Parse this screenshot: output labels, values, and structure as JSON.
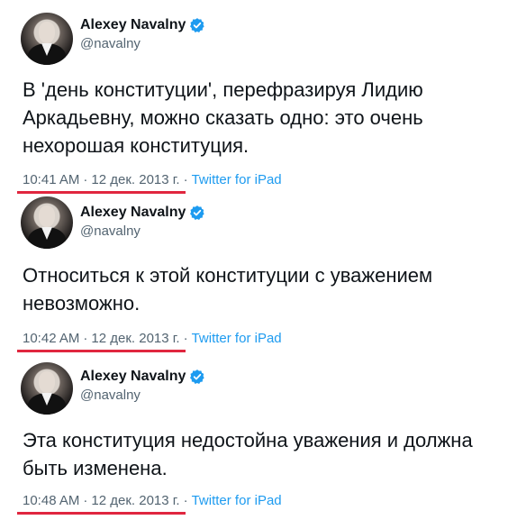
{
  "tweets": [
    {
      "author_name": "Alexey Navalny",
      "handle": "@navalny",
      "text": "В 'день конституции', перефразируя Лидию Аркадьевну, можно сказать одно: это очень нехорошая конституция.",
      "time": "10:41 AM",
      "date": "12 дек. 2013 г.",
      "source": "Twitter for iPad"
    },
    {
      "author_name": "Alexey Navalny",
      "handle": "@navalny",
      "text": "Относиться к этой конституции с уважением невозможно.",
      "time": "10:42 AM",
      "date": "12 дек. 2013 г.",
      "source": "Twitter for iPad"
    },
    {
      "author_name": "Alexey Navalny",
      "handle": "@navalny",
      "text": "Эта конституция недостойна уважения и должна быть изменена.",
      "time": "10:48 AM",
      "date": "12 дек. 2013 г.",
      "source": "Twitter for iPad"
    }
  ],
  "separator": "·",
  "colors": {
    "verified": "#1d9bf0",
    "underline": "#e0263f",
    "secondary_text": "#536471",
    "link": "#1d9bf0"
  },
  "icons": {
    "verified": "verified-badge-icon"
  }
}
